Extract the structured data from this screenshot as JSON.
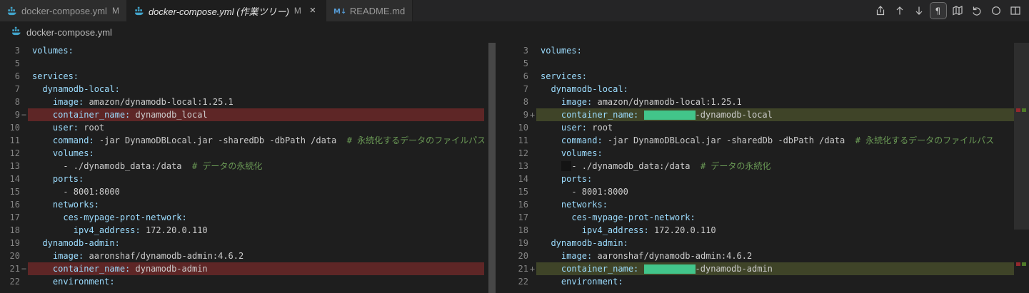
{
  "tabs": [
    {
      "icon": "docker-compose-icon",
      "label": "docker-compose.yml",
      "badge": "M",
      "active": false,
      "italic": false,
      "close_label": ""
    },
    {
      "icon": "docker-compose-icon",
      "label": "docker-compose.yml (作業ツリー)",
      "badge": "M",
      "active": true,
      "italic": true,
      "close_label": "×"
    },
    {
      "icon": "markdown-icon",
      "label": "README.md",
      "badge": "",
      "active": false,
      "italic": false,
      "close_label": ""
    }
  ],
  "toolbar": {
    "icons": [
      "open-file-icon",
      "previous-change-icon",
      "next-change-icon",
      "render-whitespace-icon",
      "map-icon",
      "discard-icon",
      "circle-icon",
      "split-editor-icon"
    ],
    "active_icon": "render-whitespace-icon"
  },
  "breadcrumb": {
    "icon": "docker-compose-icon",
    "label": "docker-compose.yml"
  },
  "colors": {
    "key": "#9cdcfe",
    "value": "#cccccc",
    "comment": "#6a9955",
    "line_number": "#858585",
    "removed_line_bg": "#5e2626",
    "added_line_bg": "#3f4428",
    "inserted_block": "#42c58a",
    "dark_box": "#141414",
    "tab_bar_bg": "#252526",
    "editor_bg": "#1e1e1e"
  },
  "editor": {
    "left": {
      "rows": [
        {
          "n": "3",
          "sign": "",
          "kind": "normal",
          "segs": [
            [
              "key",
              "volumes:"
            ]
          ]
        },
        {
          "n": "5",
          "sign": "",
          "kind": "normal",
          "segs": []
        },
        {
          "n": "6",
          "sign": "",
          "kind": "normal",
          "segs": [
            [
              "key",
              "services:"
            ]
          ]
        },
        {
          "n": "7",
          "sign": "",
          "kind": "normal",
          "segs": [
            [
              "key",
              "  dynamodb-local:"
            ]
          ]
        },
        {
          "n": "8",
          "sign": "",
          "kind": "normal",
          "segs": [
            [
              "key",
              "    image:"
            ],
            [
              "val",
              " amazon/dynamodb-local:1.25.1"
            ]
          ]
        },
        {
          "n": "9",
          "sign": "−",
          "kind": "del",
          "segs": [
            [
              "key",
              "    container_name:"
            ],
            [
              "val",
              " dynamodb_local"
            ]
          ]
        },
        {
          "n": "10",
          "sign": "",
          "kind": "normal",
          "segs": [
            [
              "key",
              "    user:"
            ],
            [
              "val",
              " root"
            ]
          ]
        },
        {
          "n": "11",
          "sign": "",
          "kind": "normal",
          "segs": [
            [
              "key",
              "    command:"
            ],
            [
              "val",
              " -jar DynamoDBLocal.jar -sharedDb -dbPath /data"
            ],
            [
              "cmt",
              "  # 永続化するデータのファイルパス"
            ]
          ]
        },
        {
          "n": "12",
          "sign": "",
          "kind": "normal",
          "segs": [
            [
              "key",
              "    volumes:"
            ]
          ]
        },
        {
          "n": "13",
          "sign": "",
          "kind": "normal",
          "segs": [
            [
              "val",
              "      - ./dynamodb_data:/data"
            ],
            [
              "cmt",
              "  # データの永続化"
            ]
          ]
        },
        {
          "n": "14",
          "sign": "",
          "kind": "normal",
          "segs": [
            [
              "key",
              "    ports:"
            ]
          ]
        },
        {
          "n": "15",
          "sign": "",
          "kind": "normal",
          "segs": [
            [
              "val",
              "      - 8001:8000"
            ]
          ]
        },
        {
          "n": "16",
          "sign": "",
          "kind": "normal",
          "segs": [
            [
              "key",
              "    networks:"
            ]
          ]
        },
        {
          "n": "17",
          "sign": "",
          "kind": "normal",
          "segs": [
            [
              "key",
              "      ces-mypage-prot-network:"
            ]
          ]
        },
        {
          "n": "18",
          "sign": "",
          "kind": "normal",
          "segs": [
            [
              "key",
              "        ipv4_address:"
            ],
            [
              "val",
              " 172.20.0.110"
            ]
          ]
        },
        {
          "n": "19",
          "sign": "",
          "kind": "normal",
          "segs": [
            [
              "key",
              "  dynamodb-admin:"
            ]
          ]
        },
        {
          "n": "20",
          "sign": "",
          "kind": "normal",
          "segs": [
            [
              "key",
              "    image:"
            ],
            [
              "val",
              " aaronshaf/dynamodb-admin:4.6.2"
            ]
          ]
        },
        {
          "n": "21",
          "sign": "−",
          "kind": "del",
          "segs": [
            [
              "key",
              "    container_name:"
            ],
            [
              "val",
              " dynamodb-admin"
            ]
          ]
        },
        {
          "n": "22",
          "sign": "",
          "kind": "normal",
          "segs": [
            [
              "key",
              "    environment:"
            ]
          ]
        }
      ]
    },
    "right": {
      "rows": [
        {
          "n": "3",
          "sign": "",
          "kind": "normal",
          "segs": [
            [
              "key",
              "volumes:"
            ]
          ]
        },
        {
          "n": "5",
          "sign": "",
          "kind": "normal",
          "segs": []
        },
        {
          "n": "6",
          "sign": "",
          "kind": "normal",
          "segs": [
            [
              "key",
              "services:"
            ]
          ]
        },
        {
          "n": "7",
          "sign": "",
          "kind": "normal",
          "segs": [
            [
              "key",
              "  dynamodb-local:"
            ]
          ]
        },
        {
          "n": "8",
          "sign": "",
          "kind": "normal",
          "segs": [
            [
              "key",
              "    image:"
            ],
            [
              "val",
              " amazon/dynamodb-local:1.25.1"
            ]
          ]
        },
        {
          "n": "9",
          "sign": "+",
          "kind": "add",
          "segs": [
            [
              "key",
              "    container_name:"
            ],
            [
              "val",
              " "
            ],
            [
              "ins",
              ""
            ],
            [
              "val",
              "-dynamodb-local"
            ]
          ]
        },
        {
          "n": "10",
          "sign": "",
          "kind": "normal",
          "segs": [
            [
              "key",
              "    user:"
            ],
            [
              "val",
              " root"
            ]
          ]
        },
        {
          "n": "11",
          "sign": "",
          "kind": "normal",
          "segs": [
            [
              "key",
              "    command:"
            ],
            [
              "val",
              " -jar DynamoDBLocal.jar -sharedDb -dbPath /data"
            ],
            [
              "cmt",
              "  # 永続化するデータのファイルパス"
            ]
          ]
        },
        {
          "n": "12",
          "sign": "",
          "kind": "normal",
          "segs": [
            [
              "key",
              "    volumes:"
            ]
          ]
        },
        {
          "n": "13",
          "sign": "",
          "kind": "normal",
          "segs": [
            [
              "val",
              "    "
            ],
            [
              "dark",
              "  "
            ],
            [
              "val",
              "- ./dynamodb_data:/data"
            ],
            [
              "cmt",
              "  # データの永続化"
            ]
          ]
        },
        {
          "n": "14",
          "sign": "",
          "kind": "normal",
          "segs": [
            [
              "key",
              "    ports:"
            ]
          ]
        },
        {
          "n": "15",
          "sign": "",
          "kind": "normal",
          "segs": [
            [
              "val",
              "      - 8001:8000"
            ]
          ]
        },
        {
          "n": "16",
          "sign": "",
          "kind": "normal",
          "segs": [
            [
              "key",
              "    networks:"
            ]
          ]
        },
        {
          "n": "17",
          "sign": "",
          "kind": "normal",
          "segs": [
            [
              "key",
              "      ces-mypage-prot-network:"
            ]
          ]
        },
        {
          "n": "18",
          "sign": "",
          "kind": "normal",
          "segs": [
            [
              "key",
              "        ipv4_address:"
            ],
            [
              "val",
              " 172.20.0.110"
            ]
          ]
        },
        {
          "n": "19",
          "sign": "",
          "kind": "normal",
          "segs": [
            [
              "key",
              "  dynamodb-admin:"
            ]
          ]
        },
        {
          "n": "20",
          "sign": "",
          "kind": "normal",
          "segs": [
            [
              "key",
              "    image:"
            ],
            [
              "val",
              " aaronshaf/dynamodb-admin:4.6.2"
            ]
          ]
        },
        {
          "n": "21",
          "sign": "+",
          "kind": "add",
          "segs": [
            [
              "key",
              "    container_name:"
            ],
            [
              "val",
              " "
            ],
            [
              "ins",
              ""
            ],
            [
              "val",
              "-dynamodb-admin"
            ]
          ]
        },
        {
          "n": "22",
          "sign": "",
          "kind": "normal",
          "segs": [
            [
              "key",
              "    environment:"
            ]
          ]
        }
      ]
    }
  }
}
